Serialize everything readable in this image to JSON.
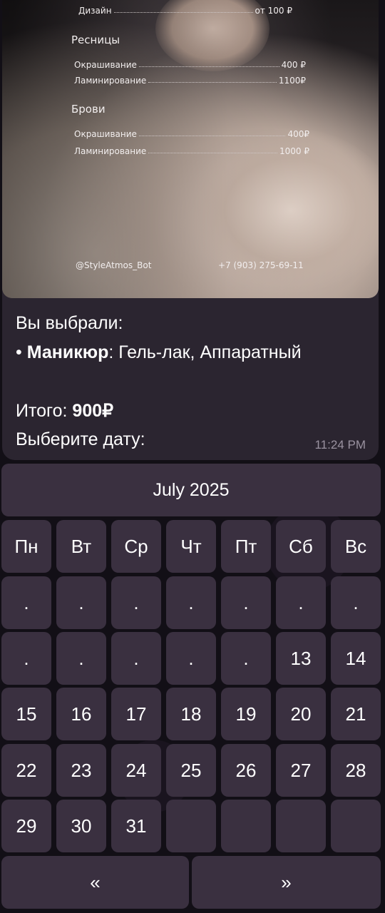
{
  "price_photo": {
    "rows_top": [
      {
        "label": "Дизайн",
        "price": "от 100 ₽"
      }
    ],
    "lashes": {
      "title": "Ресницы",
      "rows": [
        {
          "label": "Окрашивание",
          "price": "400 ₽"
        },
        {
          "label": "Ламинирование",
          "price": "1100₽"
        }
      ]
    },
    "brows": {
      "title": "Брови",
      "rows": [
        {
          "label": "Окрашивание",
          "price": "400₽"
        },
        {
          "label": "Ламинирование",
          "price": "1000 ₽"
        }
      ]
    },
    "bot_handle": "@StyleAtmos_Bot",
    "phone": "+7 (903) 275-69-11"
  },
  "message": {
    "selected_label": "Вы выбрали:",
    "bullet": "•",
    "service_name": "Маникюр",
    "service_options": ": Гель-лак, Аппаратный",
    "total_label": "Итого: ",
    "total_value": "900₽",
    "prompt": "Выберите дату:",
    "time": "11:24 PM"
  },
  "calendar": {
    "month_label": "July 2025",
    "weekdays": [
      "Пн",
      "Вт",
      "Ср",
      "Чт",
      "Пт",
      "Сб",
      "Вс"
    ],
    "weeks": [
      [
        ".",
        ".",
        ".",
        ".",
        ".",
        ".",
        "."
      ],
      [
        ".",
        ".",
        ".",
        ".",
        ".",
        "13",
        "14"
      ],
      [
        "15",
        "16",
        "17",
        "18",
        "19",
        "20",
        "21"
      ],
      [
        "22",
        "23",
        "24",
        "25",
        "26",
        "27",
        "28"
      ],
      [
        "29",
        "30",
        "31",
        "",
        "",
        "",
        ""
      ]
    ],
    "prev_label": "«",
    "next_label": "»"
  }
}
